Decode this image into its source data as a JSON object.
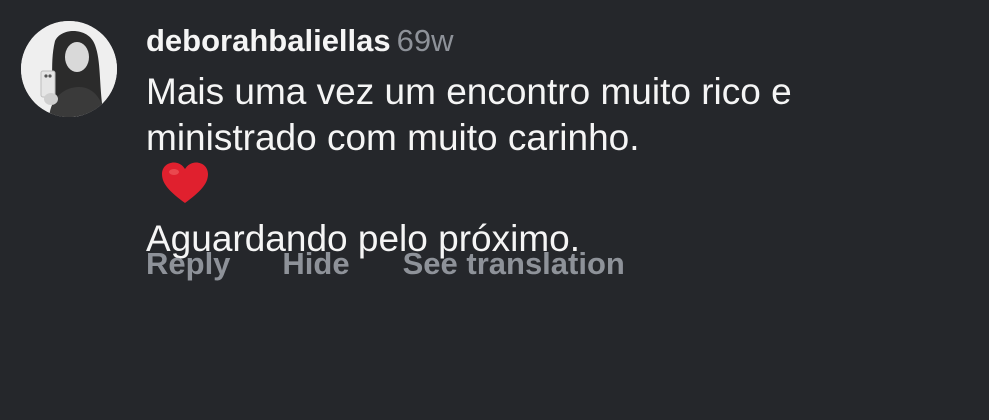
{
  "comment": {
    "avatar_icon": "user-avatar-photo",
    "username": "deborahbaliellas",
    "timestamp": "69w",
    "text_lines": [
      "Mais uma vez um encontro muito rico e",
      "ministrado com muito carinho.",
      "Aguardando pelo próximo."
    ],
    "emoji": "heart-icon",
    "actions": {
      "reply": "Reply",
      "hide": "Hide",
      "translate": "See translation"
    }
  },
  "colors": {
    "background": "#25272b",
    "primary_text": "#f5f5f5",
    "secondary_text": "#8e9299",
    "heart": "#e0202e"
  }
}
